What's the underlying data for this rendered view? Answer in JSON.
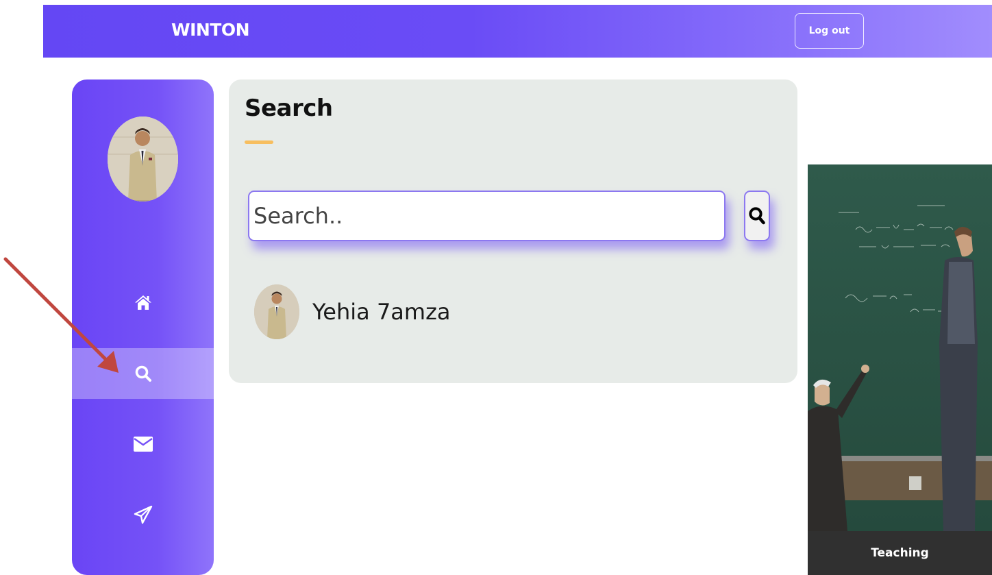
{
  "header": {
    "brand": "WINTON",
    "logout_label": "Log out"
  },
  "sidebar": {
    "avatar": "profile-photo",
    "items": [
      {
        "name": "home",
        "icon": "home-icon"
      },
      {
        "name": "search",
        "icon": "search-icon",
        "active": true
      },
      {
        "name": "messages",
        "icon": "envelope-icon"
      },
      {
        "name": "send",
        "icon": "paper-plane-icon"
      }
    ]
  },
  "search_panel": {
    "title": "Search",
    "search_placeholder": "Search..",
    "results": [
      {
        "name": "Yehia 7amza"
      }
    ]
  },
  "side_card": {
    "caption": "Teaching"
  },
  "colors": {
    "accent": "#6a4cf6",
    "accent_light": "#a18dfd",
    "underline": "#f7be5f",
    "panel_bg": "#e7ebe8",
    "annotation_arrow": "#c0473f"
  }
}
